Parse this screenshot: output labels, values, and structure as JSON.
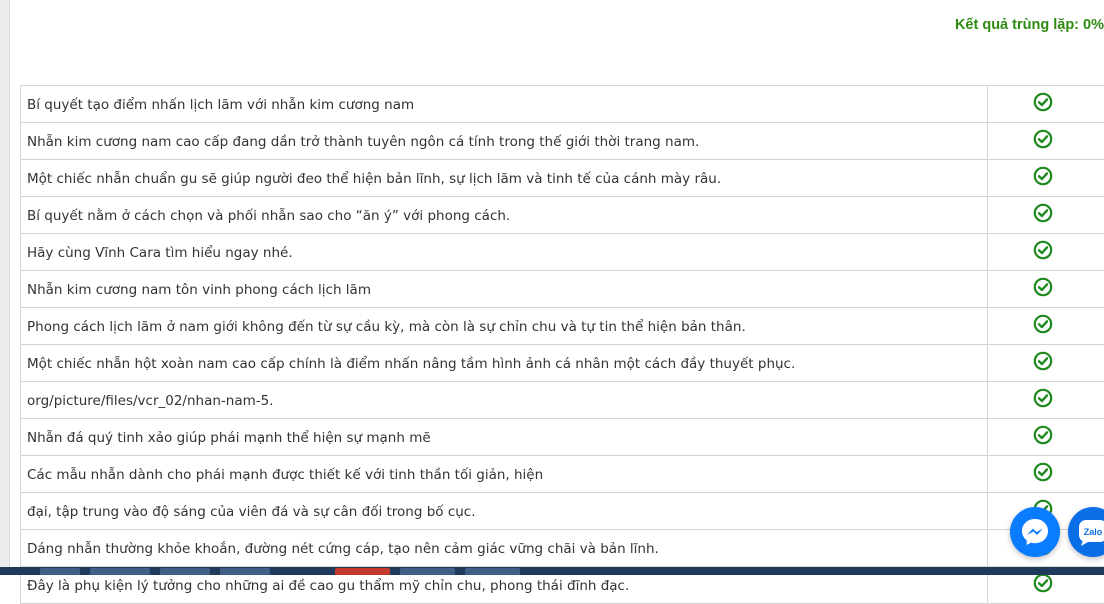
{
  "result": {
    "label": "Kết quả trùng lặp: 0%"
  },
  "rows": [
    {
      "text": "Bí quyết tạo điểm nhấn lịch lãm với nhẫn kim cương nam",
      "status": "ok"
    },
    {
      "text": "Nhẫn kim cương nam cao cấp đang dần trở thành tuyên ngôn cá tính trong thế giới thời trang nam.",
      "status": "ok"
    },
    {
      "text": "Một chiếc nhẫn chuẩn gu sẽ giúp người đeo thể hiện bản lĩnh, sự lịch lãm và tinh tế của cánh mày râu.",
      "status": "ok"
    },
    {
      "text": "Bí quyết nằm ở cách chọn và phối nhẫn sao cho “ăn ý” với phong cách.",
      "status": "ok"
    },
    {
      "text": "Hãy cùng Vĩnh Cara tìm hiểu ngay nhé.",
      "status": "ok"
    },
    {
      "text": "Nhẫn kim cương nam tôn vinh phong cách lịch lãm",
      "status": "ok"
    },
    {
      "text": "Phong cách lịch lãm ở nam giới không đến từ sự cầu kỳ, mà còn là sự chỉn chu và tự tin thể hiện bản thân.",
      "status": "ok"
    },
    {
      "text": "Một chiếc nhẫn hột xoàn nam cao cấp chính là điểm nhấn nâng tầm hình ảnh cá nhân một cách đầy thuyết phục.",
      "status": "ok"
    },
    {
      "text": "org/picture/files/vcr_02/nhan-nam-5.",
      "status": "ok"
    },
    {
      "text": "Nhẫn đá quý tinh xảo giúp phái mạnh thể hiện sự mạnh mẽ",
      "status": "ok"
    },
    {
      "text": "Các mẫu nhẫn dành cho phái mạnh được thiết kế với tinh thần tối giản, hiện",
      "status": "ok"
    },
    {
      "text": "đại, tập trung vào độ sáng của viên đá và sự cân đối trong bố cục.",
      "status": "ok"
    },
    {
      "text": "Dáng nhẫn thường khỏe khoắn, đường nét cứng cáp, tạo nên cảm giác vững chãi và bản lĩnh.",
      "status": "ok"
    },
    {
      "text": "Đây là phụ kiện lý tưởng cho những ai đề cao gu thẩm mỹ chỉn chu, phong thái đĩnh đạc.",
      "status": "ok"
    }
  ],
  "fabs": {
    "zalo_label": "Zalo"
  },
  "colors": {
    "accent_green": "#2e8b12",
    "check_green": "#1e8a1e",
    "messenger_blue": "#0a7cff",
    "zalo_blue": "#0a6ee6"
  },
  "icons": {
    "check": "check-circle-icon",
    "messenger": "messenger-icon",
    "zalo": "zalo-icon"
  }
}
